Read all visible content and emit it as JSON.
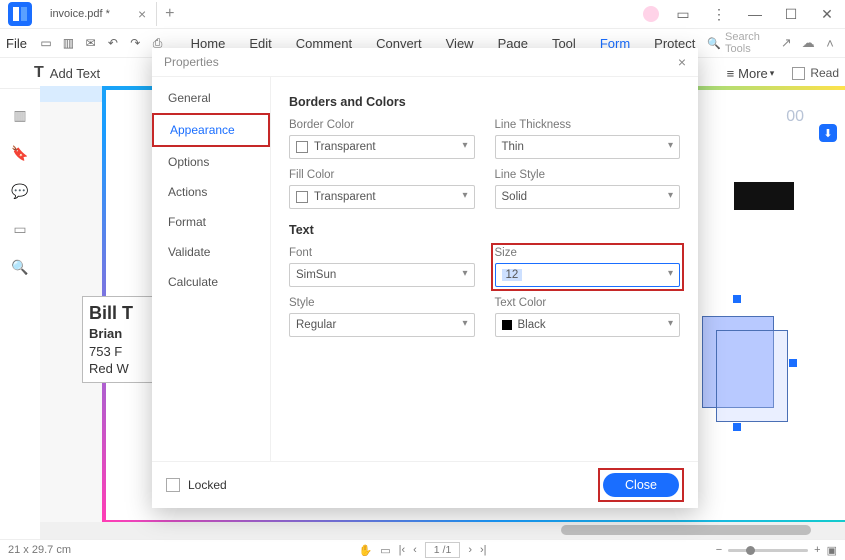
{
  "titlebar": {
    "doc_name": "invoice.pdf *"
  },
  "menubar": {
    "file": "File",
    "items": [
      "Home",
      "Edit",
      "Comment",
      "Convert",
      "View",
      "Page",
      "Tool",
      "Form",
      "Protect"
    ],
    "active_index": 7,
    "search_placeholder": "Search Tools"
  },
  "toolbar": {
    "add_text": "Add Text",
    "more": "More",
    "read": "Read"
  },
  "canvas": {
    "bill_title": "Bill T",
    "bill_name": "Brian",
    "bill_addr1": "753 F",
    "bill_addr2": "Red W",
    "top_number": "00"
  },
  "panel": {
    "title": "Properties",
    "tabs": [
      "General",
      "Appearance",
      "Options",
      "Actions",
      "Format",
      "Validate",
      "Calculate"
    ],
    "selected_tab": 1,
    "section_borders": "Borders and Colors",
    "section_text": "Text",
    "labels": {
      "border_color": "Border Color",
      "line_thickness": "Line Thickness",
      "fill_color": "Fill Color",
      "line_style": "Line Style",
      "font": "Font",
      "size": "Size",
      "style": "Style",
      "text_color": "Text Color"
    },
    "values": {
      "border_color": "Transparent",
      "line_thickness": "Thin",
      "fill_color": "Transparent",
      "line_style": "Solid",
      "font": "SimSun",
      "size": "12",
      "style": "Regular",
      "text_color": "Black"
    },
    "locked": "Locked",
    "close": "Close"
  },
  "statusbar": {
    "dims": "21 x 29.7 cm",
    "page": "1 /1"
  }
}
